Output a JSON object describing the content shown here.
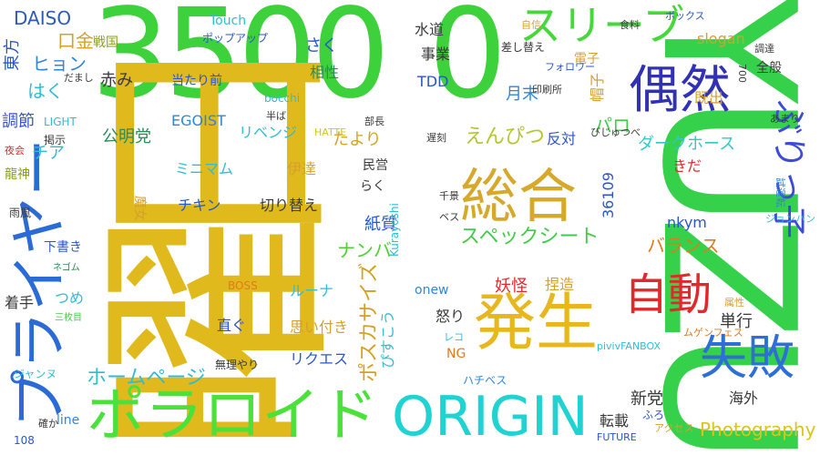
{
  "words": [
    {
      "text": "3500",
      "color": "#3dd13b"
    },
    {
      "text": "0",
      "color": "#3dd13b"
    },
    {
      "text": "曜日",
      "color": "#e0ba1c"
    },
    {
      "text": "YUZU",
      "color": "#35d14a"
    },
    {
      "text": "ORIGIN",
      "color": "#1fd3d3"
    },
    {
      "text": "ポラロイド",
      "color": "#49e13a"
    },
    {
      "text": "プライヤー",
      "color": "#2a6bd6"
    },
    {
      "text": "総合",
      "color": "#d6a92b"
    },
    {
      "text": "偶然",
      "color": "#3131b6"
    },
    {
      "text": "発生",
      "color": "#e8b71e"
    },
    {
      "text": "自動",
      "color": "#e0292b"
    },
    {
      "text": "失敗",
      "color": "#2e6fd6"
    },
    {
      "text": "スリーブ",
      "color": "#46d83b"
    },
    {
      "text": "ぶりっ子",
      "color": "#3c4bd8"
    },
    {
      "text": "ホームページ",
      "color": "#2fbcd6"
    },
    {
      "text": "スペックシート",
      "color": "#40cc4a"
    },
    {
      "text": "ポスカサイズ",
      "color": "#d6a020"
    },
    {
      "text": "えんぴつ",
      "color": "#b6c531"
    },
    {
      "text": "Photography",
      "color": "#d8c51e"
    },
    {
      "text": "ダークホース",
      "color": "#31c8c6"
    },
    {
      "text": "ナンバ",
      "color": "#4ed130"
    },
    {
      "text": "バランス",
      "color": "#e07a1c"
    },
    {
      "text": "DAISO",
      "color": "#2e5bb8"
    },
    {
      "text": "ヒョン",
      "color": "#2f86d8"
    },
    {
      "text": "口金",
      "color": "#d6a02b"
    },
    {
      "text": "東方",
      "color": "#2a56c8"
    },
    {
      "text": "戦国",
      "color": "#8a9e1c"
    },
    {
      "text": "赤み",
      "color": "#3a3a3a"
    },
    {
      "text": "はく",
      "color": "#2fbdd4"
    },
    {
      "text": "調節",
      "color": "#3b53c8"
    },
    {
      "text": "チア",
      "color": "#2fbdd4"
    },
    {
      "text": "龍神",
      "color": "#8a9e1c"
    },
    {
      "text": "公明党",
      "color": "#2e8b57"
    },
    {
      "text": "ミニマム",
      "color": "#2fbdd4"
    },
    {
      "text": "チキン",
      "color": "#2a56c8"
    },
    {
      "text": "当たり前",
      "color": "#2a56c8"
    },
    {
      "text": "EGOIST",
      "color": "#2f86d8"
    },
    {
      "text": "リベンジ",
      "color": "#2fbdd4"
    },
    {
      "text": "伊達",
      "color": "#d6a02b"
    },
    {
      "text": "切り替え",
      "color": "#3a3a3a"
    },
    {
      "text": "さく",
      "color": "#2a56c8"
    },
    {
      "text": "相性",
      "color": "#2e8b57"
    },
    {
      "text": "たより",
      "color": "#d6a02b"
    },
    {
      "text": "紙質",
      "color": "#2a56c8"
    },
    {
      "text": "らく",
      "color": "#3a3a3a"
    },
    {
      "text": "ルーナ",
      "color": "#2fbdd4"
    },
    {
      "text": "直ぐ",
      "color": "#2a56c8"
    },
    {
      "text": "思い付き",
      "color": "#d6a02b"
    },
    {
      "text": "リクエス",
      "color": "#2a56c8"
    },
    {
      "text": "ぴすこう",
      "color": "#2fbdd4"
    },
    {
      "text": "民営",
      "color": "#3a3a3a"
    },
    {
      "text": "妖怪",
      "color": "#e0292b"
    },
    {
      "text": "怒り",
      "color": "#3a3a3a"
    },
    {
      "text": "捏造",
      "color": "#d6a02b"
    },
    {
      "text": "onew",
      "color": "#2f86d8"
    },
    {
      "text": "NG",
      "color": "#e07a1c"
    },
    {
      "text": "水道",
      "color": "#3a3a3a"
    },
    {
      "text": "事業",
      "color": "#3a3a3a"
    },
    {
      "text": "月末",
      "color": "#2f86d8"
    },
    {
      "text": "TDD",
      "color": "#2a56c8"
    },
    {
      "text": "パロ",
      "color": "#40cc4a"
    },
    {
      "text": "反対",
      "color": "#2a56c8"
    },
    {
      "text": "36109",
      "color": "#2a56c8"
    },
    {
      "text": "nkym",
      "color": "#2a56c8"
    },
    {
      "text": "きだ",
      "color": "#e0292b"
    },
    {
      "text": "帽子",
      "color": "#d6a02b"
    },
    {
      "text": "単行",
      "color": "#3a3a3a"
    },
    {
      "text": "海外",
      "color": "#3a3a3a"
    },
    {
      "text": "新党",
      "color": "#3a3a3a"
    },
    {
      "text": "転載",
      "color": "#3a3a3a"
    },
    {
      "text": "slogan",
      "color": "#d6a02b"
    },
    {
      "text": "全般",
      "color": "#3a3a3a"
    },
    {
      "text": "既出",
      "color": "#d6a02b"
    },
    {
      "text": "line",
      "color": "#2f86d8"
    },
    {
      "text": "着手",
      "color": "#3a3a3a"
    },
    {
      "text": "つめ",
      "color": "#2fbdd4"
    },
    {
      "text": "下書き",
      "color": "#2a56c8"
    },
    {
      "text": "Touch",
      "color": "#2fbdd4"
    },
    {
      "text": "ポップアップ",
      "color": "#2a56c8"
    },
    {
      "text": "bocchi",
      "color": "#2fbdd4"
    },
    {
      "text": "LIGHT",
      "color": "#2fbdd4"
    },
    {
      "text": "HATTE",
      "color": "#d6c51e"
    },
    {
      "text": "BOSS",
      "color": "#e07a1c"
    },
    {
      "text": "無理やり",
      "color": "#3a3a3a"
    },
    {
      "text": "ジャンヌ",
      "color": "#2fbdd4"
    },
    {
      "text": "三枚目",
      "color": "#40cc4a"
    },
    {
      "text": "ネゴム",
      "color": "#2e8b57"
    },
    {
      "text": "雨風",
      "color": "#3a3a3a"
    },
    {
      "text": "夜会",
      "color": "#e0292b"
    },
    {
      "text": "掲示",
      "color": "#3a3a3a"
    },
    {
      "text": "だまし",
      "color": "#3a3a3a"
    },
    {
      "text": "半ば",
      "color": "#3a3a3a"
    },
    {
      "text": "部長",
      "color": "#3a3a3a"
    },
    {
      "text": "遅刻",
      "color": "#3a3a3a"
    },
    {
      "text": "魔女",
      "color": "#d6a02b"
    },
    {
      "text": "Kurayoshi",
      "color": "#2fbdd4"
    },
    {
      "text": "千景",
      "color": "#3a3a3a"
    },
    {
      "text": "ベス",
      "color": "#3a3a3a"
    },
    {
      "text": "レコ",
      "color": "#2fbdd4"
    },
    {
      "text": "ハチベス",
      "color": "#2f86d8"
    },
    {
      "text": "確か",
      "color": "#3a3a3a"
    },
    {
      "text": "108",
      "color": "#2a56c8"
    },
    {
      "text": "FUTURE",
      "color": "#2a56c8"
    },
    {
      "text": "ふろ",
      "color": "#2a56c8"
    },
    {
      "text": "アクセス",
      "color": "#d6a02b"
    },
    {
      "text": "pivivFANBOX",
      "color": "#2fbdd4"
    },
    {
      "text": "ムゲンフェス",
      "color": "#e07a1c"
    },
    {
      "text": "属性",
      "color": "#d6a02b"
    },
    {
      "text": "ジョンハン",
      "color": "#2fbdd4"
    },
    {
      "text": "試運転",
      "color": "#2f86d8"
    },
    {
      "text": "あまり",
      "color": "#3a3a3a"
    },
    {
      "text": "びじゅつべ",
      "color": "#3a3a3a"
    },
    {
      "text": "印刷所",
      "color": "#3a3a3a"
    },
    {
      "text": "電子",
      "color": "#d6a02b"
    },
    {
      "text": "700",
      "color": "#3a3a3a"
    },
    {
      "text": "調達",
      "color": "#3a3a3a"
    },
    {
      "text": "フォロワー",
      "color": "#2a56c8"
    },
    {
      "text": "差し替え",
      "color": "#3a3a3a"
    },
    {
      "text": "自信",
      "color": "#d6a02b"
    },
    {
      "text": "食料",
      "color": "#3a3a3a"
    },
    {
      "text": "ボックス",
      "color": "#2a56c8"
    }
  ]
}
